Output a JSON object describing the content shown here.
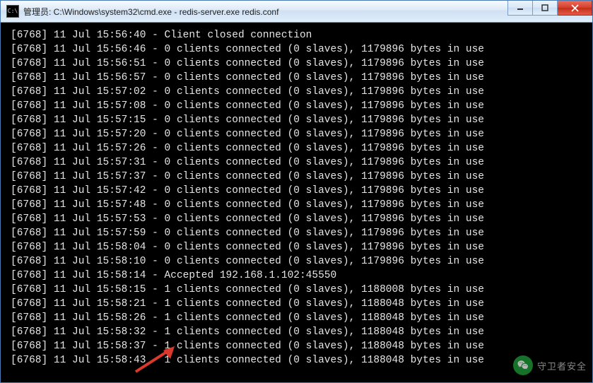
{
  "window": {
    "icon_glyph": "C:\\",
    "title": "管理员: C:\\Windows\\system32\\cmd.exe - redis-server.exe  redis.conf"
  },
  "controls": {
    "minimize": "minimize",
    "maximize": "maximize",
    "close": "close"
  },
  "terminal_lines": [
    "[6768] 11 Jul 15:56:40 - Client closed connection",
    "[6768] 11 Jul 15:56:46 - 0 clients connected (0 slaves), 1179896 bytes in use",
    "[6768] 11 Jul 15:56:51 - 0 clients connected (0 slaves), 1179896 bytes in use",
    "[6768] 11 Jul 15:56:57 - 0 clients connected (0 slaves), 1179896 bytes in use",
    "[6768] 11 Jul 15:57:02 - 0 clients connected (0 slaves), 1179896 bytes in use",
    "[6768] 11 Jul 15:57:08 - 0 clients connected (0 slaves), 1179896 bytes in use",
    "[6768] 11 Jul 15:57:15 - 0 clients connected (0 slaves), 1179896 bytes in use",
    "[6768] 11 Jul 15:57:20 - 0 clients connected (0 slaves), 1179896 bytes in use",
    "[6768] 11 Jul 15:57:26 - 0 clients connected (0 slaves), 1179896 bytes in use",
    "[6768] 11 Jul 15:57:31 - 0 clients connected (0 slaves), 1179896 bytes in use",
    "[6768] 11 Jul 15:57:37 - 0 clients connected (0 slaves), 1179896 bytes in use",
    "[6768] 11 Jul 15:57:42 - 0 clients connected (0 slaves), 1179896 bytes in use",
    "[6768] 11 Jul 15:57:48 - 0 clients connected (0 slaves), 1179896 bytes in use",
    "[6768] 11 Jul 15:57:53 - 0 clients connected (0 slaves), 1179896 bytes in use",
    "[6768] 11 Jul 15:57:59 - 0 clients connected (0 slaves), 1179896 bytes in use",
    "[6768] 11 Jul 15:58:04 - 0 clients connected (0 slaves), 1179896 bytes in use",
    "[6768] 11 Jul 15:58:10 - 0 clients connected (0 slaves), 1179896 bytes in use",
    "[6768] 11 Jul 15:58:14 - Accepted 192.168.1.102:45550",
    "[6768] 11 Jul 15:58:15 - 1 clients connected (0 slaves), 1188008 bytes in use",
    "[6768] 11 Jul 15:58:21 - 1 clients connected (0 slaves), 1188048 bytes in use",
    "[6768] 11 Jul 15:58:26 - 1 clients connected (0 slaves), 1188048 bytes in use",
    "[6768] 11 Jul 15:58:32 - 1 clients connected (0 slaves), 1188048 bytes in use",
    "[6768] 11 Jul 15:58:37 - 1 clients connected (0 slaves), 1188048 bytes in use",
    "[6768] 11 Jul 15:58:43 - 1 clients connected (0 slaves), 1188048 bytes in use"
  ],
  "watermark": {
    "text": "守卫者安全"
  },
  "annotation": {
    "arrow_color": "#d93a2b"
  }
}
